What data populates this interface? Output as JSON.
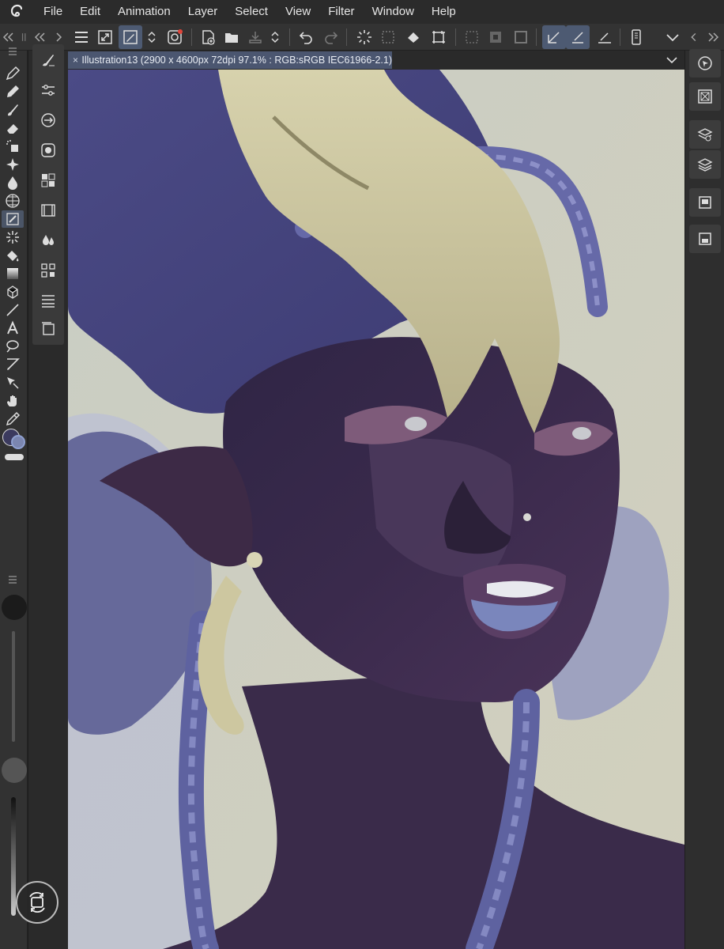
{
  "menubar": {
    "logo_icon": "clip-studio-logo-icon",
    "items": [
      "File",
      "Edit",
      "Animation",
      "Layer",
      "Select",
      "View",
      "Filter",
      "Window",
      "Help"
    ]
  },
  "document": {
    "tab_title": "Illustration13 (2900 x 4600px 72dpi 97.1% : RGB:sRGB IEC61966-2.1)",
    "close_glyph": "×"
  },
  "colors": {
    "accent": "#4d5a72",
    "main_color": "#3b3a5e",
    "sub_color": "#7b86b0"
  }
}
